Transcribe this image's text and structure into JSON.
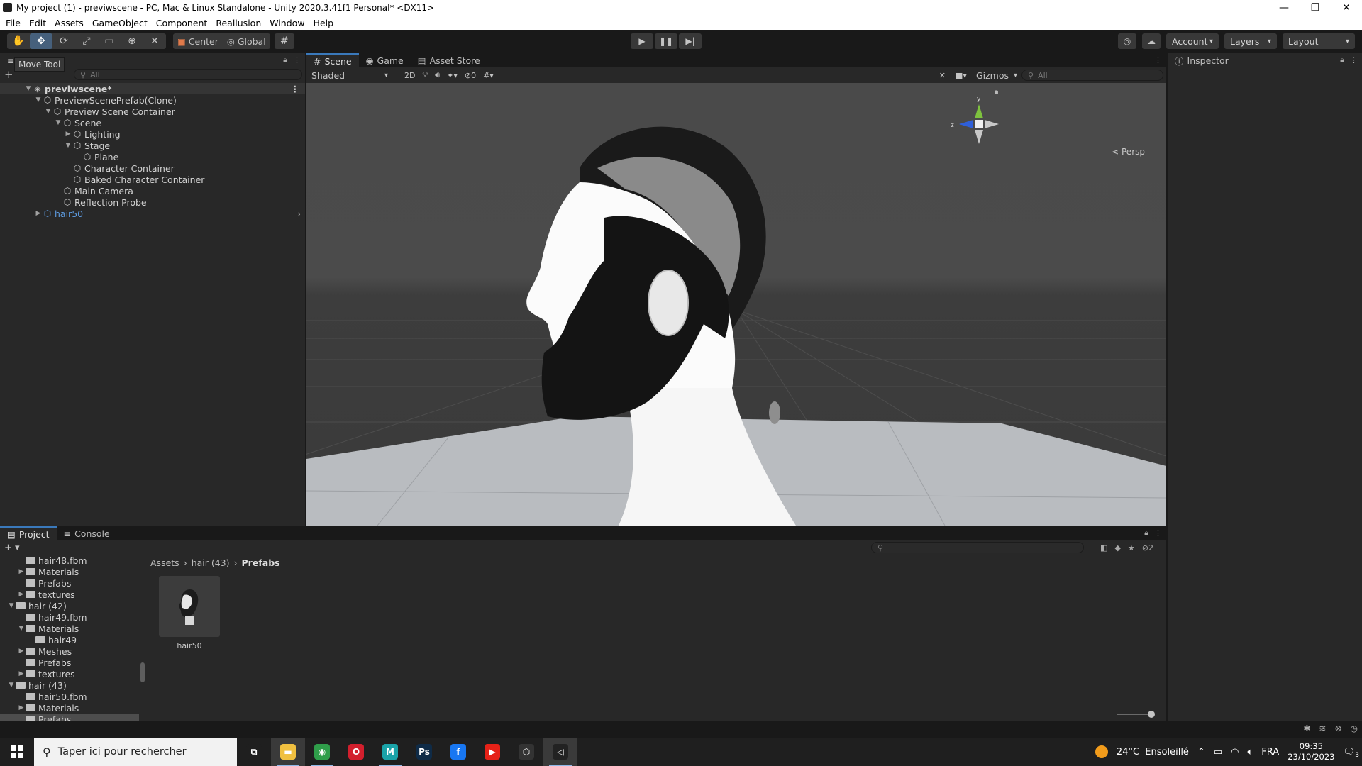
{
  "window": {
    "title": "My project (1) - previwscene - PC, Mac & Linux Standalone - Unity 2020.3.41f1 Personal* <DX11>",
    "controls": [
      "—",
      "❐",
      "✕"
    ]
  },
  "menu": [
    "File",
    "Edit",
    "Assets",
    "GameObject",
    "Component",
    "Reallusion",
    "Window",
    "Help"
  ],
  "toolbar": {
    "tools": [
      "hand-icon",
      "move-icon",
      "rotate-icon",
      "scale-icon",
      "rect-icon",
      "transform-icon",
      "custom-tool-icon"
    ],
    "active_tool": "move-icon",
    "pivot": "Center",
    "space": "Global",
    "account": "Account",
    "layers": "Layers",
    "layout": "Layout"
  },
  "tooltip": "Move Tool",
  "hierarchy": {
    "search_placeholder": "All",
    "rows": [
      {
        "label": "previwscene*",
        "depth": 0,
        "arrow": "▼",
        "kind": "scene"
      },
      {
        "label": "PreviewScenePrefab(Clone)",
        "depth": 1,
        "arrow": "▼",
        "kind": "object"
      },
      {
        "label": "Preview Scene Container",
        "depth": 2,
        "arrow": "▼",
        "kind": "object"
      },
      {
        "label": "Scene",
        "depth": 3,
        "arrow": "▼",
        "kind": "object"
      },
      {
        "label": "Lighting",
        "depth": 4,
        "arrow": "▶",
        "kind": "object"
      },
      {
        "label": "Stage",
        "depth": 4,
        "arrow": "▼",
        "kind": "object"
      },
      {
        "label": "Plane",
        "depth": 5,
        "arrow": "",
        "kind": "object"
      },
      {
        "label": "Character Container",
        "depth": 4,
        "arrow": "",
        "kind": "object"
      },
      {
        "label": "Baked Character Container",
        "depth": 4,
        "arrow": "",
        "kind": "object"
      },
      {
        "label": "Main Camera",
        "depth": 3,
        "arrow": "",
        "kind": "object"
      },
      {
        "label": "Reflection Probe",
        "depth": 3,
        "arrow": "",
        "kind": "object"
      },
      {
        "label": "hair50",
        "depth": 1,
        "arrow": "▶",
        "kind": "prefab"
      }
    ]
  },
  "scene_tabs": [
    {
      "label": "Scene",
      "icon": "#",
      "active": true
    },
    {
      "label": "Game",
      "icon": "◉",
      "active": false
    },
    {
      "label": "Asset Store",
      "icon": "▤",
      "active": false
    }
  ],
  "scene_toolbar": {
    "shading": "Shaded",
    "mode_2d": "2D",
    "hidden_count": "0",
    "gizmos": "Gizmos",
    "search_placeholder": "All",
    "projection": "Persp"
  },
  "inspector": {
    "tab": "Inspector"
  },
  "project": {
    "tabs": [
      {
        "label": "Project",
        "icon": "▤",
        "active": true
      },
      {
        "label": "Console",
        "icon": "≡",
        "active": false
      }
    ],
    "hidden_count": "2",
    "breadcrumb": [
      "Assets",
      "hair (43)",
      "Prefabs"
    ],
    "folders": [
      {
        "label": "hair48.fbm",
        "depth": 2,
        "arrow": "",
        "open": false,
        "selected": false
      },
      {
        "label": "Materials",
        "depth": 2,
        "arrow": "▶",
        "open": false,
        "selected": false
      },
      {
        "label": "Prefabs",
        "depth": 2,
        "arrow": "",
        "open": false,
        "selected": false
      },
      {
        "label": "textures",
        "depth": 2,
        "arrow": "▶",
        "open": false,
        "selected": false
      },
      {
        "label": "hair (42)",
        "depth": 1,
        "arrow": "▼",
        "open": true,
        "selected": false
      },
      {
        "label": "hair49.fbm",
        "depth": 2,
        "arrow": "",
        "open": false,
        "selected": false
      },
      {
        "label": "Materials",
        "depth": 2,
        "arrow": "▼",
        "open": true,
        "selected": false
      },
      {
        "label": "hair49",
        "depth": 3,
        "arrow": "",
        "open": false,
        "selected": false
      },
      {
        "label": "Meshes",
        "depth": 2,
        "arrow": "▶",
        "open": false,
        "selected": false
      },
      {
        "label": "Prefabs",
        "depth": 2,
        "arrow": "",
        "open": false,
        "selected": false
      },
      {
        "label": "textures",
        "depth": 2,
        "arrow": "▶",
        "open": false,
        "selected": false
      },
      {
        "label": "hair (43)",
        "depth": 1,
        "arrow": "▼",
        "open": true,
        "selected": false
      },
      {
        "label": "hair50.fbm",
        "depth": 2,
        "arrow": "",
        "open": false,
        "selected": false
      },
      {
        "label": "Materials",
        "depth": 2,
        "arrow": "▶",
        "open": false,
        "selected": false
      },
      {
        "label": "Prefabs",
        "depth": 2,
        "arrow": "",
        "open": false,
        "selected": true
      }
    ],
    "assets": [
      {
        "label": "hair50"
      }
    ]
  },
  "taskbar": {
    "search_placeholder": "Taper ici pour rechercher",
    "apps": [
      {
        "name": "task-view",
        "glyph": "⧉",
        "color": "#1f1f1f",
        "running": false,
        "active": false
      },
      {
        "name": "file-explorer",
        "glyph": "▬",
        "color": "#f0c040",
        "running": true,
        "active": true
      },
      {
        "name": "chrome",
        "glyph": "◉",
        "color": "#2f9e4a",
        "running": true,
        "active": false
      },
      {
        "name": "opera",
        "glyph": "O",
        "color": "#d21f2d",
        "running": false,
        "active": false
      },
      {
        "name": "maya",
        "glyph": "M",
        "color": "#1aa3a8",
        "running": true,
        "active": false
      },
      {
        "name": "photoshop",
        "glyph": "Ps",
        "color": "#0f2b47",
        "running": false,
        "active": false
      },
      {
        "name": "facebook",
        "glyph": "f",
        "color": "#1877f2",
        "running": false,
        "active": false
      },
      {
        "name": "youtube",
        "glyph": "▶",
        "color": "#e62117",
        "running": false,
        "active": false
      },
      {
        "name": "unity-hub",
        "glyph": "⬡",
        "color": "#333333",
        "running": false,
        "active": false
      },
      {
        "name": "unity-editor",
        "glyph": "◁",
        "color": "#222222",
        "running": true,
        "active": true
      }
    ],
    "weather": "24°C  Ensoleillé",
    "language": "FRA",
    "time": "09:35",
    "date": "23/10/2023",
    "notifications": "3"
  }
}
